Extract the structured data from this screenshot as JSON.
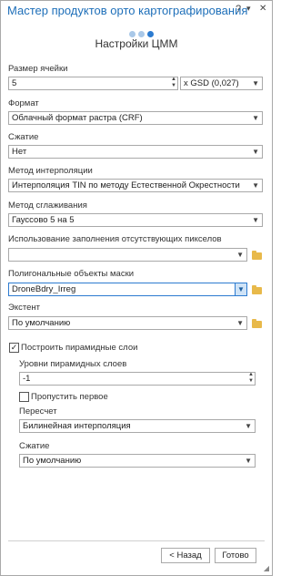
{
  "window": {
    "title": "Мастер продуктов орто картографирования",
    "help": "?",
    "pin": "▾",
    "close": "✕"
  },
  "wizard": {
    "steps": 3,
    "page_title": "Настройки ЦММ"
  },
  "cell_size": {
    "label": "Размер ячейки",
    "value": "5",
    "unit_value": "x GSD (0,027)"
  },
  "format": {
    "label": "Формат",
    "value": "Облачный формат растра (CRF)"
  },
  "compression": {
    "label": "Сжатие",
    "value": "Нет"
  },
  "interp_method": {
    "label": "Метод интерполяции",
    "value": "Интерполяция TIN по методу Естественной Окрестности"
  },
  "smoothing": {
    "label": "Метод сглаживания",
    "value": "Гауссово 5 на 5"
  },
  "fill_missing": {
    "label": "Использование заполнения отсутствующих пикселов",
    "value": ""
  },
  "mask": {
    "label": "Полигональные объекты маски",
    "value": "DroneBdry_Irreg"
  },
  "extent": {
    "label": "Экстент",
    "value": "По умолчанию"
  },
  "pyramids": {
    "checkbox_label": "Построить пирамидные слои",
    "checked": true,
    "levels_label": "Уровни пирамидных слоев",
    "levels_value": "-1",
    "skip_first_label": "Пропустить первое",
    "skip_first_checked": false,
    "resample_label": "Пересчет",
    "resample_value": "Билинейная интерполяция",
    "compression_label": "Сжатие",
    "compression_value": "По умолчанию"
  },
  "footer": {
    "back": "< Назад",
    "finish": "Готово"
  },
  "colors": {
    "accent": "#2c7bd0",
    "title": "#1e6fb9"
  }
}
